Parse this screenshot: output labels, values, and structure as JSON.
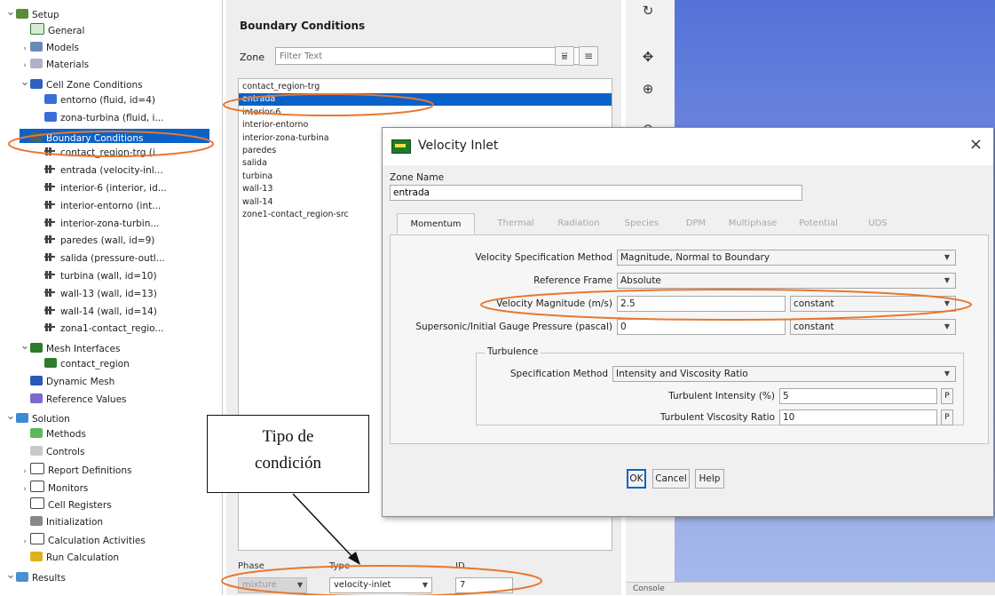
{
  "tree": {
    "items": [
      {
        "label": "Setup",
        "indent": 0,
        "caret": "v",
        "icon": "setup"
      },
      {
        "label": "General",
        "indent": 1,
        "caret": "",
        "icon": "general"
      },
      {
        "label": "Models",
        "indent": 1,
        "caret": ">",
        "icon": "models"
      },
      {
        "label": "Materials",
        "indent": 1,
        "caret": ">",
        "icon": "materials"
      },
      {
        "label": "Cell Zone Conditions",
        "indent": 1,
        "caret": "v",
        "icon": "cellzone"
      },
      {
        "label": "entorno (fluid, id=4)",
        "indent": 2,
        "caret": "",
        "icon": "fluid"
      },
      {
        "label": "zona-turbina (fluid, i...",
        "indent": 2,
        "caret": "",
        "icon": "fluid"
      },
      {
        "label": "Boundary Conditions",
        "indent": 1,
        "caret": "v",
        "icon": "bc",
        "selected": true
      },
      {
        "label": "contact_region-trg (i...",
        "indent": 2,
        "caret": "",
        "icon": "bcitem"
      },
      {
        "label": "entrada (velocity-inl...",
        "indent": 2,
        "caret": "",
        "icon": "bcitem"
      },
      {
        "label": "interior-6 (interior, id...",
        "indent": 2,
        "caret": "",
        "icon": "bcitem"
      },
      {
        "label": "interior-entorno (int...",
        "indent": 2,
        "caret": "",
        "icon": "bcitem"
      },
      {
        "label": "interior-zona-turbin...",
        "indent": 2,
        "caret": "",
        "icon": "bcitem"
      },
      {
        "label": "paredes (wall, id=9)",
        "indent": 2,
        "caret": "",
        "icon": "bcitem"
      },
      {
        "label": "salida (pressure-outl...",
        "indent": 2,
        "caret": "",
        "icon": "bcitem"
      },
      {
        "label": "turbina (wall, id=10)",
        "indent": 2,
        "caret": "",
        "icon": "bcitem"
      },
      {
        "label": "wall-13 (wall, id=13)",
        "indent": 2,
        "caret": "",
        "icon": "bcitem"
      },
      {
        "label": "wall-14 (wall, id=14)",
        "indent": 2,
        "caret": "",
        "icon": "bcitem"
      },
      {
        "label": "zona1-contact_regio...",
        "indent": 2,
        "caret": "",
        "icon": "bcitem"
      },
      {
        "label": "Mesh Interfaces",
        "indent": 1,
        "caret": "v",
        "icon": "mesh"
      },
      {
        "label": "contact_region",
        "indent": 2,
        "caret": "",
        "icon": "mesh"
      },
      {
        "label": "Dynamic Mesh",
        "indent": 1,
        "caret": "",
        "icon": "dyn"
      },
      {
        "label": "Reference Values",
        "indent": 1,
        "caret": "",
        "icon": "ref"
      },
      {
        "label": "Solution",
        "indent": 0,
        "caret": "v",
        "icon": "solution"
      },
      {
        "label": "Methods",
        "indent": 1,
        "caret": "",
        "icon": "methods"
      },
      {
        "label": "Controls",
        "indent": 1,
        "caret": "",
        "icon": "controls"
      },
      {
        "label": "Report Definitions",
        "indent": 1,
        "caret": ">",
        "icon": "report"
      },
      {
        "label": "Monitors",
        "indent": 1,
        "caret": ">",
        "icon": "report"
      },
      {
        "label": "Cell Registers",
        "indent": 1,
        "caret": "",
        "icon": "report"
      },
      {
        "label": "Initialization",
        "indent": 1,
        "caret": "",
        "icon": "init"
      },
      {
        "label": "Calculation Activities",
        "indent": 1,
        "caret": ">",
        "icon": "calc"
      },
      {
        "label": "Run Calculation",
        "indent": 1,
        "caret": "",
        "icon": "run"
      },
      {
        "label": "Results",
        "indent": 0,
        "caret": "v",
        "icon": "results"
      }
    ]
  },
  "bc_panel": {
    "title": "Boundary Conditions",
    "zone_label": "Zone",
    "filter_placeholder": "Filter Text",
    "zones": [
      "contact_region-trg",
      "entrada",
      "interior-6",
      "interior-entorno",
      "interior-zona-turbina",
      "paredes",
      "salida",
      "turbina",
      "wall-13",
      "wall-14",
      "zone1-contact_region-src"
    ],
    "selected_zone": "entrada",
    "phase_label": "Phase",
    "phase_value": "mixture",
    "type_label": "Type",
    "type_value": "velocity-inlet",
    "id_label": "ID",
    "id_value": "7"
  },
  "console": {
    "label": "Console"
  },
  "dialog": {
    "title": "Velocity Inlet",
    "close": "×",
    "zone_name_label": "Zone Name",
    "zone_name_value": "entrada",
    "tabs": [
      "Momentum",
      "Thermal",
      "Radiation",
      "Species",
      "DPM",
      "Multiphase",
      "Potential",
      "UDS"
    ],
    "active_tab": "Momentum",
    "velocity_spec_label": "Velocity Specification Method",
    "velocity_spec_value": "Magnitude, Normal to Boundary",
    "ref_frame_label": "Reference Frame",
    "ref_frame_value": "Absolute",
    "vel_mag_label": "Velocity Magnitude (m/s)",
    "vel_mag_value": "2.5",
    "vel_mag_method": "constant",
    "gauge_label": "Supersonic/Initial Gauge Pressure (pascal)",
    "gauge_value": "0",
    "gauge_method": "constant",
    "turbulence_label": "Turbulence",
    "spec_method_label": "Specification Method",
    "spec_method_value": "Intensity and Viscosity Ratio",
    "intensity_label": "Turbulent Intensity (%)",
    "intensity_value": "5",
    "viscosity_label": "Turbulent Viscosity Ratio",
    "viscosity_value": "10",
    "p_label": "P",
    "ok": "OK",
    "cancel": "Cancel",
    "help": "Help"
  },
  "annotation": {
    "line1": "Tipo de",
    "line2": "condición"
  },
  "colors": {
    "selection": "#0a62c8",
    "annotation_ellipse": "#e8772e",
    "viewport_top": "#5572d8",
    "viewport_bottom": "#a8b9ec"
  }
}
